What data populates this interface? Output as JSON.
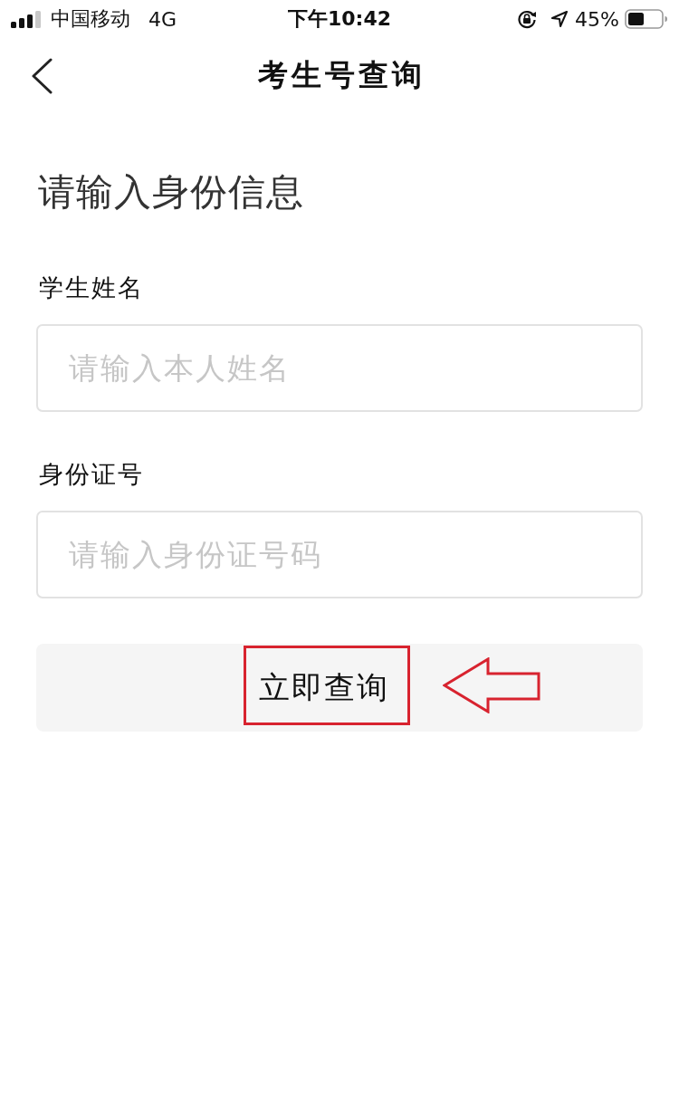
{
  "status_bar": {
    "carrier": "中国移动",
    "network": "4G",
    "time": "下午10:42",
    "battery_text": "45%"
  },
  "nav_bar": {
    "title": "考生号查询"
  },
  "form": {
    "heading": "请输入身份信息",
    "fields": [
      {
        "label": "学生姓名",
        "placeholder": "请输入本人姓名"
      },
      {
        "label": "身份证号",
        "placeholder": "请输入身份证号码"
      }
    ],
    "submit": "立即查询"
  },
  "annotations": [
    {
      "kind": "highlight-box"
    },
    {
      "kind": "arrow"
    }
  ]
}
